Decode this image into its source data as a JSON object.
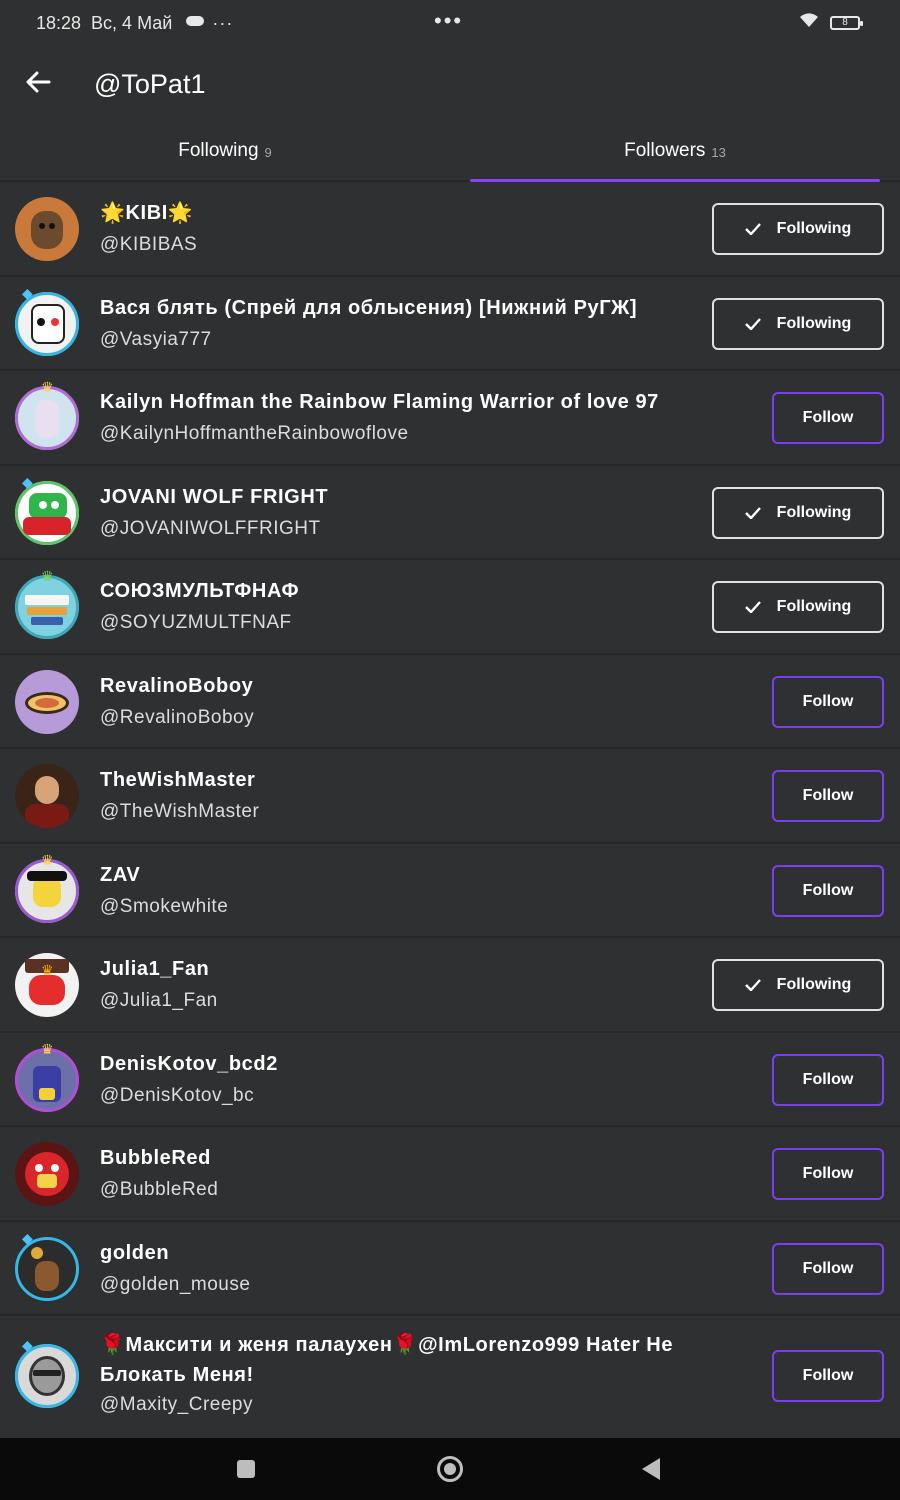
{
  "status": {
    "time": "18:28",
    "date": "Вс, 4 Май",
    "more": "···",
    "center_dots": "•••",
    "battery": "8"
  },
  "header": {
    "title": "@ToPat1"
  },
  "tabs": [
    {
      "label": "Following",
      "count": "9"
    },
    {
      "label": "Followers",
      "count": "13"
    }
  ],
  "colors": {
    "accent": "#8a3ffc",
    "background": "#2f3031",
    "divider": "#262728"
  },
  "users": [
    {
      "display_name": "🌟KIBI🌟",
      "username": "@KIBIBAS",
      "button": "Following"
    },
    {
      "display_name": "Вася блять (Спрей для облысения) [Нижний РуГЖ]",
      "username": "@Vasyia777",
      "button": "Following"
    },
    {
      "display_name": "Kailyn Hoffman the Rainbow Flaming Warrior of love 97",
      "username": "@KailynHoffmantheRainbowoflove",
      "button": "Follow"
    },
    {
      "display_name": "JOVANI WOLF FRIGHT",
      "username": "@JOVANIWOLFFRIGHT",
      "button": "Following"
    },
    {
      "display_name": "СОЮЗМУЛЬТФНАФ",
      "username": "@SOYUZMULTFNAF",
      "button": "Following"
    },
    {
      "display_name": "RevalinoBoboy",
      "username": "@RevalinoBoboy",
      "button": "Follow"
    },
    {
      "display_name": "TheWishMaster",
      "username": "@TheWishMaster",
      "button": "Follow"
    },
    {
      "display_name": "ZAV",
      "username": "@Smokewhite",
      "button": "Follow"
    },
    {
      "display_name": "Julia1_Fan",
      "username": "@Julia1_Fan",
      "button": "Following"
    },
    {
      "display_name": "DenisKotov_bcd2",
      "username": "@DenisKotov_bc",
      "button": "Follow"
    },
    {
      "display_name": "BubbleRed",
      "username": "@BubbleRed",
      "button": "Follow"
    },
    {
      "display_name": "golden",
      "username": "@golden_mouse",
      "button": "Follow"
    },
    {
      "display_name": "🌹Максити и женя палаухен🌹@ImLorenzo999 Hater Не Блокать Меня!",
      "username": "@Maxity_Creepy",
      "button": "Follow"
    }
  ]
}
